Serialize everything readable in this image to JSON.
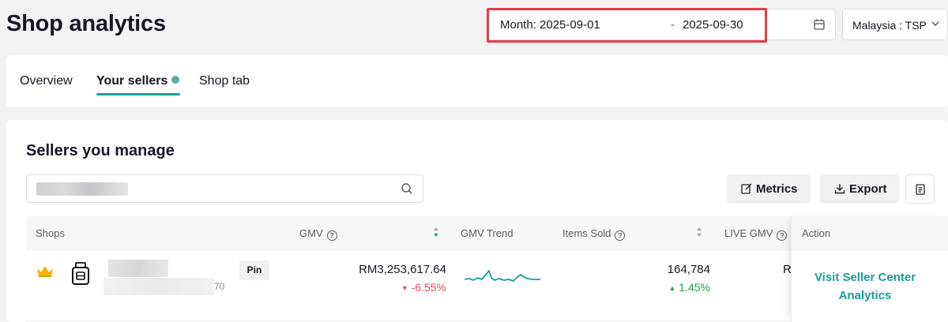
{
  "page": {
    "title": "Shop analytics"
  },
  "date_filter": {
    "label": "Month: 2025-09-01",
    "separator": "-",
    "end": "2025-09-30"
  },
  "region": {
    "value": "Malaysia : TSP"
  },
  "tabs": [
    {
      "label": "Overview",
      "active": false
    },
    {
      "label": "Your sellers",
      "active": true,
      "has_dot": true
    },
    {
      "label": "Shop tab",
      "active": false
    }
  ],
  "section": {
    "title": "Sellers you manage"
  },
  "toolbar": {
    "metrics_label": "Metrics",
    "export_label": "Export"
  },
  "table": {
    "columns": [
      "Shops",
      "GMV",
      "GMV Trend",
      "Items Sold",
      "LIVE GMV",
      "Action"
    ],
    "rows": [
      {
        "shop_suffix": "70",
        "pin_label": "Pin",
        "gmv": "RM3,253,617.64",
        "gmv_change": "-6.55%",
        "items_sold": "164,784",
        "items_change": "1.45%",
        "live_gmv_partial": "R",
        "action_label": "Visit Seller Center Analytics"
      }
    ]
  },
  "colors": {
    "accent": "#1a9f95",
    "negative": "#e84a5f",
    "positive": "#16a34a",
    "highlight": "#ea3a45"
  }
}
